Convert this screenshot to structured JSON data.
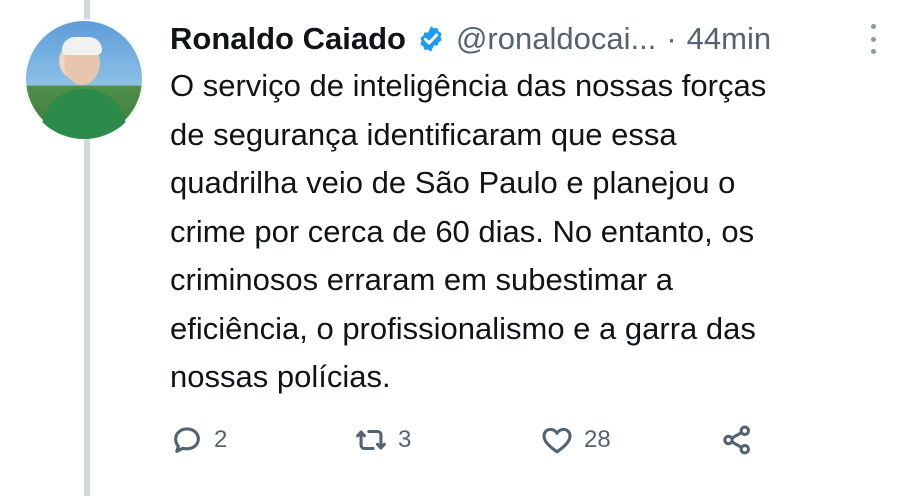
{
  "tweet": {
    "author_name": "Ronaldo Caiado",
    "handle": "@ronaldocai...",
    "separator": "·",
    "time": "44min",
    "verified_icon": "verified-badge-icon",
    "text": "O serviço de inteligência das nossas forças\nde segurança identificaram que essa\nquadrilha veio de São Paulo e planejou o\ncrime por cerca de 60 dias. No entanto, os\ncriminosos erraram em subestimar a\neficiência, o profissionalismo e a garra das\nnossas polícias.",
    "actions": {
      "replies": "2",
      "retweets": "3",
      "likes": "28"
    }
  },
  "colors": {
    "text": "#0f1419",
    "secondary": "#536471",
    "verified": "#1d9bf0",
    "thread_line": "#cfd9de"
  }
}
